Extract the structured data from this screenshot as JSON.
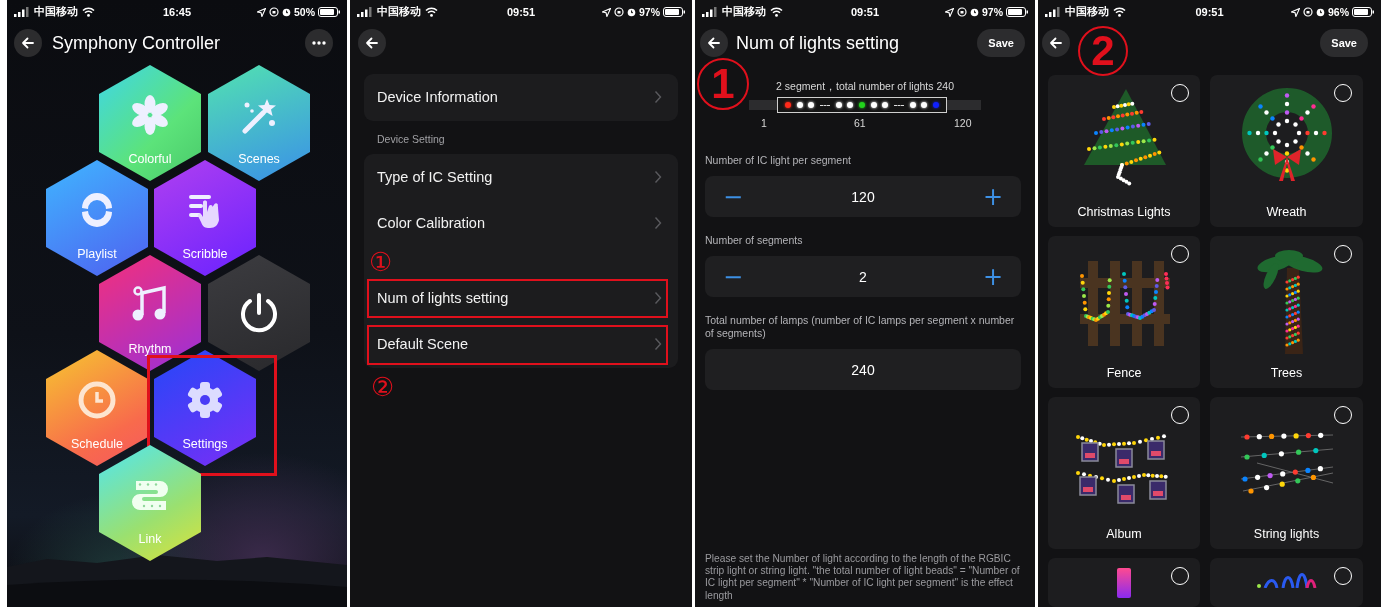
{
  "home": {
    "status_bar": {
      "carrier": "中国移动",
      "time": "16:45",
      "battery": "50%"
    },
    "title": "Symphony Controller",
    "tiles": [
      {
        "kind": "colorful",
        "label": "Colorful",
        "highlighted": false
      },
      {
        "kind": "scenes",
        "label": "Scenes",
        "highlighted": false
      },
      {
        "kind": "playlist",
        "label": "Playlist",
        "highlighted": false
      },
      {
        "kind": "scribble",
        "label": "Scribble",
        "highlighted": false
      },
      {
        "kind": "rhythm",
        "label": "Rhythm",
        "highlighted": false
      },
      {
        "kind": "power",
        "highlighted": false
      },
      {
        "kind": "schedule",
        "label": "Schedule",
        "highlighted": false
      },
      {
        "kind": "settings",
        "label": "Settings",
        "highlighted": true
      },
      {
        "kind": "link",
        "label": "Link",
        "highlighted": false
      }
    ]
  },
  "device_settings": {
    "status_bar": {
      "carrier": "中国移动",
      "time": "09:51",
      "battery": "97%"
    },
    "general": [
      {
        "label": "Device Information"
      }
    ],
    "section_label": "Device Setting",
    "items": [
      {
        "kind": "row",
        "label": "Type of IC Setting",
        "highlighted": false
      },
      {
        "kind": "row",
        "label": "Color Calibration",
        "highlighted": false
      },
      {
        "kind": "marker",
        "label": "①"
      },
      {
        "kind": "row",
        "label": "Num of lights setting",
        "highlighted": true
      },
      {
        "kind": "row",
        "label": "Default Scene",
        "highlighted": true
      }
    ],
    "footer_marker": "②"
  },
  "num_lights": {
    "status_bar": {
      "carrier": "中国移动",
      "time": "09:51",
      "battery": "97%"
    },
    "title": "Num of lights setting",
    "save": "Save",
    "annotation": "1",
    "strip_caption": "2 segment，total number of lights 240",
    "strip": [
      {
        "kind": "dot",
        "color": "#ff2a1a"
      },
      {
        "kind": "dot",
        "color": "#ffffff"
      },
      {
        "kind": "dot",
        "color": "#ffffff"
      },
      {
        "kind": "gap"
      },
      {
        "kind": "dot",
        "color": "#ffffff"
      },
      {
        "kind": "dot",
        "color": "#ffffff"
      },
      {
        "kind": "dot",
        "color": "#22d41c"
      },
      {
        "kind": "dot",
        "color": "#ffffff"
      },
      {
        "kind": "dot",
        "color": "#ffffff"
      },
      {
        "kind": "gap"
      },
      {
        "kind": "dot",
        "color": "#ffffff"
      },
      {
        "kind": "dot",
        "color": "#ffffff"
      },
      {
        "kind": "dot",
        "color": "#1020ff"
      }
    ],
    "strip_ticks": [
      "1",
      "61",
      "120"
    ],
    "fields": [
      {
        "kind": "stepper",
        "label": "Number of IC light per segment",
        "decrement": "−",
        "value": "120",
        "increment": "+"
      },
      {
        "kind": "stepper",
        "label": "Number of segments",
        "decrement": "−",
        "value": "2",
        "increment": "+"
      },
      {
        "kind": "readout",
        "label": "Total number of lamps (number of IC lamps per segment x number of segments)",
        "value": "240"
      }
    ],
    "note": "Please set the Number of light according to the length of the RGBIC strip light or string light. \"the total number of light beads\" = \"Number of IC light per segment\" * \"Number of IC light per segment\" is the effect length"
  },
  "default_scene": {
    "status_bar": {
      "carrier": "中国移动",
      "time": "09:51",
      "battery": "96%"
    },
    "save": "Save",
    "annotation": "2",
    "scenes": [
      {
        "kind": "christmas_tree",
        "label": "Christmas Lights",
        "selected": false
      },
      {
        "kind": "wreath",
        "label": "Wreath",
        "selected": false
      },
      {
        "kind": "fence",
        "label": "Fence",
        "selected": false
      },
      {
        "kind": "palm",
        "label": "Trees",
        "selected": false
      },
      {
        "kind": "album",
        "label": "Album",
        "selected": false
      },
      {
        "kind": "string",
        "label": "String lights",
        "selected": false
      },
      {
        "kind": "lamp",
        "selected": false
      },
      {
        "kind": "strip",
        "selected": false
      }
    ]
  }
}
